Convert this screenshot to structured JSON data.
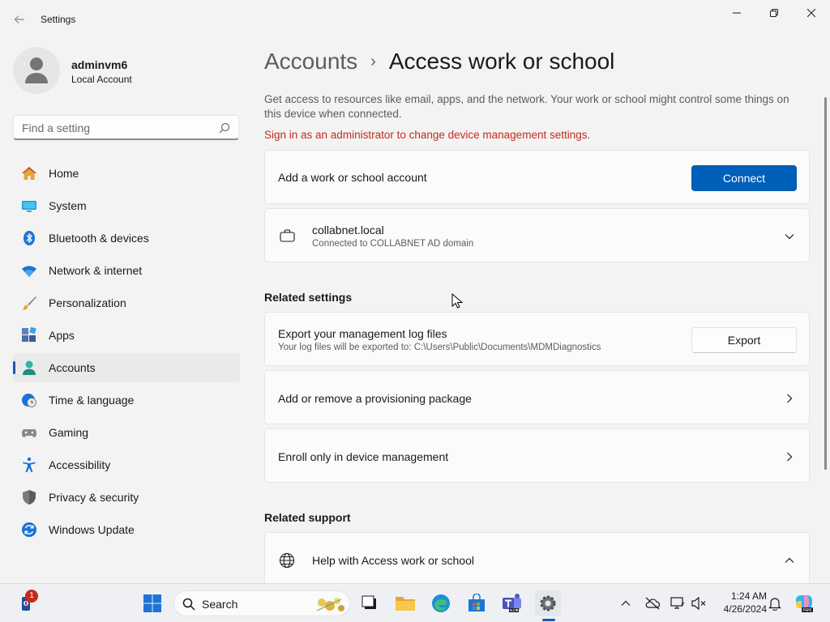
{
  "window": {
    "title": "Settings"
  },
  "profile": {
    "name": "adminvm6",
    "account_type": "Local Account"
  },
  "search": {
    "placeholder": "Find a setting"
  },
  "sidebar": {
    "items": [
      {
        "label": "Home",
        "icon": "home-icon"
      },
      {
        "label": "System",
        "icon": "system-icon"
      },
      {
        "label": "Bluetooth & devices",
        "icon": "bluetooth-icon"
      },
      {
        "label": "Network & internet",
        "icon": "wifi-icon"
      },
      {
        "label": "Personalization",
        "icon": "brush-icon"
      },
      {
        "label": "Apps",
        "icon": "apps-icon"
      },
      {
        "label": "Accounts",
        "icon": "accounts-icon",
        "active": true
      },
      {
        "label": "Time & language",
        "icon": "clock-globe-icon"
      },
      {
        "label": "Gaming",
        "icon": "gamepad-icon"
      },
      {
        "label": "Accessibility",
        "icon": "accessibility-icon"
      },
      {
        "label": "Privacy & security",
        "icon": "shield-icon"
      },
      {
        "label": "Windows Update",
        "icon": "update-icon"
      }
    ]
  },
  "breadcrumb": {
    "parent": "Accounts",
    "separator": "›",
    "current": "Access work or school"
  },
  "main": {
    "description": "Get access to resources like email, apps, and the network. Your work or school might control some things on this device when connected.",
    "warning": "Sign in as an administrator to change device management settings.",
    "add_account": {
      "label": "Add a work or school account",
      "button": "Connect"
    },
    "connected_account": {
      "name": "collabnet.local",
      "status": "Connected to COLLABNET AD domain"
    },
    "related_settings_title": "Related settings",
    "export_logs": {
      "title": "Export your management log files",
      "subtitle": "Your log files will be exported to: C:\\Users\\Public\\Documents\\MDMDiagnostics",
      "button": "Export"
    },
    "provisioning": {
      "label": "Add or remove a provisioning package"
    },
    "enroll": {
      "label": "Enroll only in device management"
    },
    "related_support_title": "Related support",
    "help": {
      "label": "Help with Access work or school"
    }
  },
  "taskbar": {
    "search_label": "Search",
    "notification_count": "1",
    "clock_time": "1:24 AM",
    "clock_date": "4/26/2024",
    "apps": [
      "windows-start",
      "file-explorer",
      "edge",
      "microsoft-store",
      "teams",
      "settings"
    ]
  },
  "colors": {
    "accent": "#005fb8",
    "warning": "#c42b1c",
    "background": "#f3f3f3",
    "card": "#fbfbfb"
  }
}
